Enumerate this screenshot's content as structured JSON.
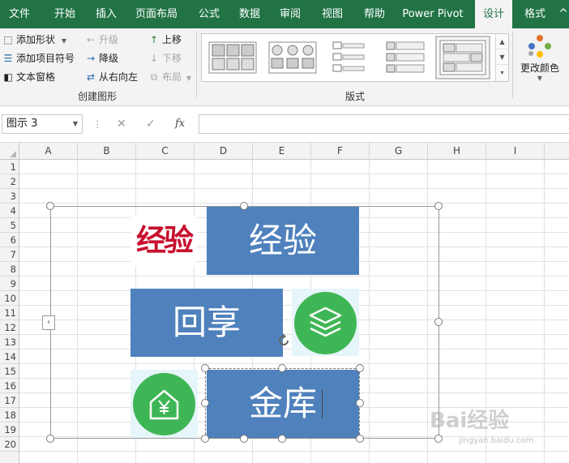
{
  "ribbon_tabs": [
    "文件",
    "开始",
    "插入",
    "页面布局",
    "公式",
    "数据",
    "审阅",
    "视图",
    "帮助",
    "Power Pivot",
    "设计",
    "格式"
  ],
  "active_tab": "设计",
  "create_graphic": {
    "add_shape": "添加形状",
    "add_bullet": "添加项目符号",
    "text_pane": "文本窗格",
    "promote": "升级",
    "demote": "降级",
    "right_to_left": "从右向左",
    "move_up": "上移",
    "move_down": "下移",
    "layout": "布局",
    "group_label": "创建图形"
  },
  "layouts": {
    "group_label": "版式"
  },
  "change_colors": "更改颜色",
  "formula_bar": {
    "name_box": "图示 3",
    "cancel": "✕",
    "enter": "✓",
    "fx": "fx",
    "value": ""
  },
  "columns": [
    "A",
    "B",
    "C",
    "D",
    "E",
    "F",
    "G",
    "H",
    "I"
  ],
  "rows": [
    "1",
    "2",
    "3",
    "4",
    "5",
    "6",
    "7",
    "8",
    "9",
    "10",
    "11",
    "12",
    "13",
    "14",
    "15",
    "16",
    "17",
    "18",
    "19",
    "20"
  ],
  "smartart": {
    "logo_text": "经验",
    "box1": "经验",
    "box2": "回享",
    "box3": "金库"
  },
  "watermark": {
    "brand": "Bai经验",
    "url": "jingyan.baidu.com"
  },
  "colors": {
    "excel_green": "#217346",
    "shape_blue": "#4f81bd",
    "icon_green": "#3fb655",
    "logo_red": "#c8102e"
  }
}
